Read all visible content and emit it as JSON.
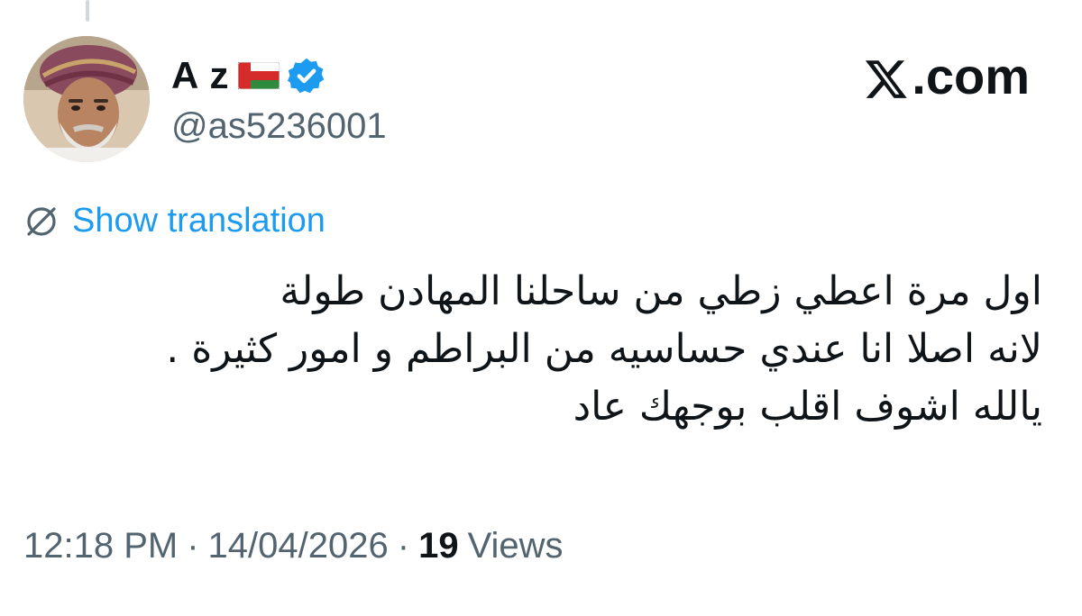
{
  "author": {
    "display_name": "A z",
    "handle": "@as5236001",
    "flag_icon": "oman-flag-icon",
    "verified_icon": "verified-badge-icon",
    "verified_color": "#1d9bf0"
  },
  "brand": {
    "logo_icon": "x-logo-icon",
    "suffix": ".com"
  },
  "translate": {
    "icon": "globe-slash-icon",
    "label": "Show translation",
    "color": "#1d9bf0"
  },
  "tweet": {
    "lines": [
      "اول مرة اعطي زطي من ساحلنا المهادن طولة",
      "لانه اصلا انا عندي حساسيه من البراطم و امور كثيرة .",
      "يالله اشوف اقلب بوجهك عاد"
    ]
  },
  "meta": {
    "time": "12:18 PM",
    "separator": "·",
    "date": "14/04/2026",
    "views_count": "19",
    "views_label": "Views"
  }
}
